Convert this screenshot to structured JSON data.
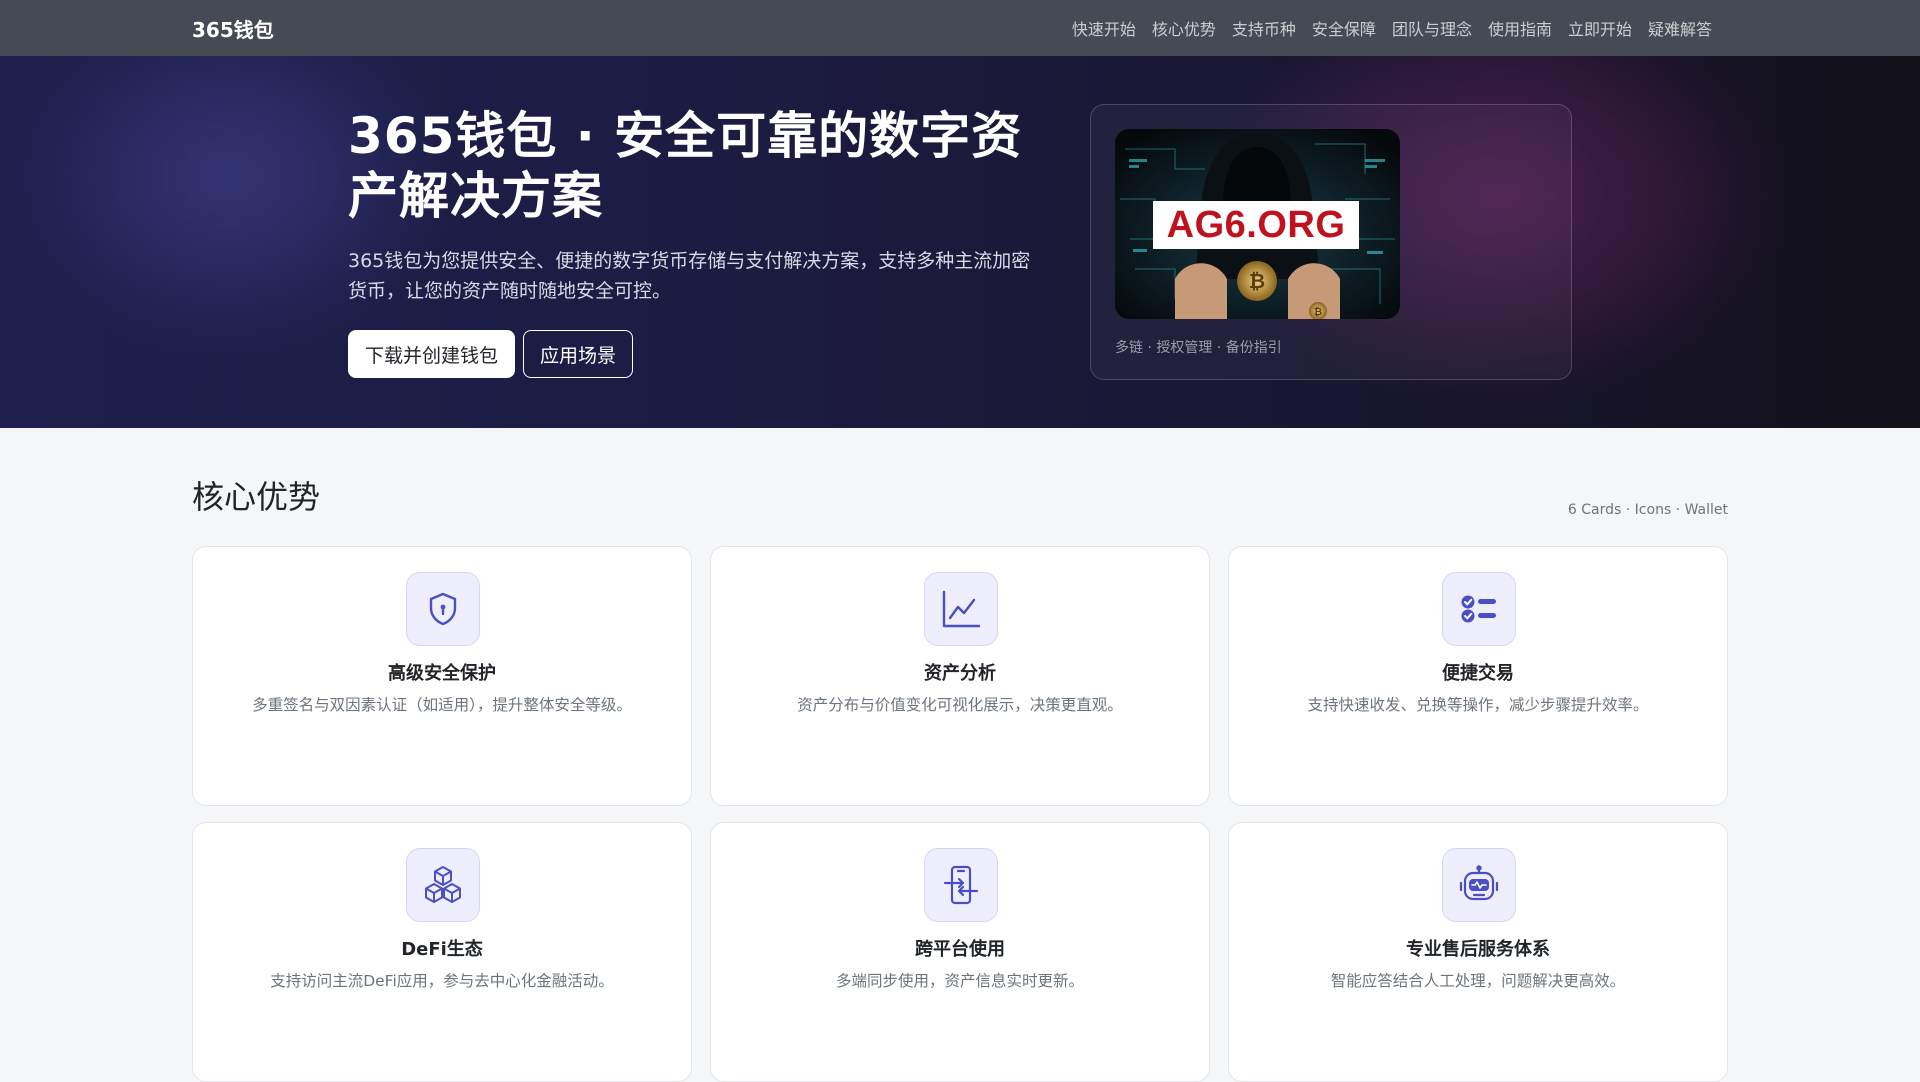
{
  "navbar": {
    "brand": "365钱包",
    "links": [
      "快速开始",
      "核心优势",
      "支持币种",
      "安全保障",
      "团队与理念",
      "使用指南",
      "立即开始",
      "疑难解答"
    ]
  },
  "hero": {
    "title": "365钱包 · 安全可靠的数字资产解决方案",
    "subtitle": "365钱包为您提供安全、便捷的数字货币存储与支付解决方案，支持多种主流加密货币，让您的资产随时随地安全可控。",
    "primary_button": "下载并创建钱包",
    "secondary_button": "应用场景",
    "image_label": "AG6.ORG",
    "caption": "多链 · 授权管理 · 备份指引"
  },
  "features": {
    "title": "核心优势",
    "meta": "6 Cards · Icons · Wallet",
    "cards": [
      {
        "icon": "shield-keyhole-icon",
        "title": "高级安全保护",
        "desc": "多重签名与双因素认证（如适用），提升整体安全等级。"
      },
      {
        "icon": "line-chart-icon",
        "title": "资产分析",
        "desc": "资产分布与价值变化可视化展示，决策更直观。"
      },
      {
        "icon": "checklist-icon",
        "title": "便捷交易",
        "desc": "支持快速收发、兑换等操作，减少步骤提升效率。"
      },
      {
        "icon": "boxes-icon",
        "title": "DeFi生态",
        "desc": "支持访问主流DeFi应用，参与去中心化金融活动。"
      },
      {
        "icon": "phone-sync-icon",
        "title": "跨平台使用",
        "desc": "多端同步使用，资产信息实时更新。"
      },
      {
        "icon": "robot-icon",
        "title": "专业售后服务体系",
        "desc": "智能应答结合人工处理，问题解决更高效。"
      }
    ]
  },
  "colors": {
    "navbar": "#464a55",
    "accent_icon": "#4b4fc4",
    "image_label_text": "#c0111f"
  }
}
